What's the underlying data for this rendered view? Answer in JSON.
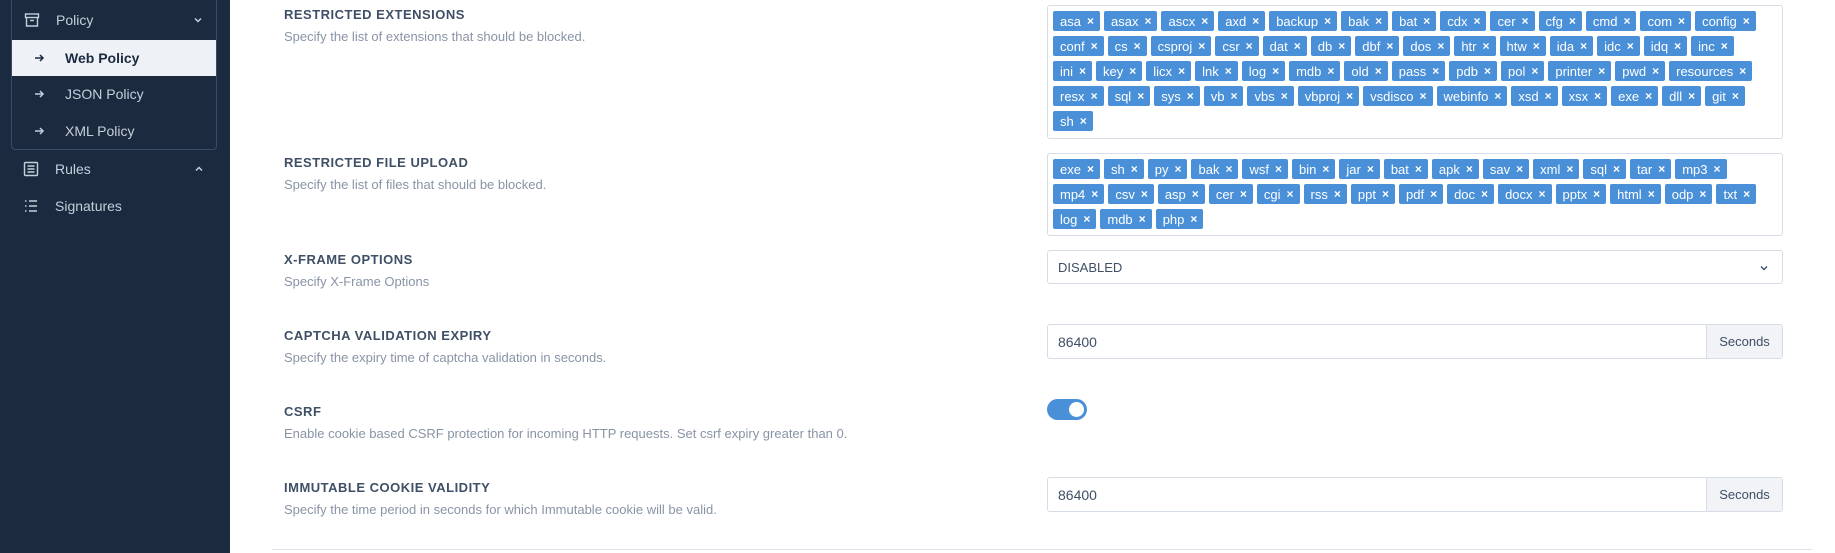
{
  "sidebar": {
    "policy_group": {
      "label": "Policy",
      "items": [
        {
          "label": "Web Policy",
          "active": true
        },
        {
          "label": "JSON Policy",
          "active": false
        },
        {
          "label": "XML Policy",
          "active": false
        }
      ]
    },
    "rules": {
      "label": "Rules"
    },
    "signatures": {
      "label": "Signatures"
    }
  },
  "settings": {
    "restricted_extensions": {
      "title": "RESTRICTED EXTENSIONS",
      "description": "Specify the list of extensions that should be blocked.",
      "tags": [
        "asa",
        "asax",
        "ascx",
        "axd",
        "backup",
        "bak",
        "bat",
        "cdx",
        "cer",
        "cfg",
        "cmd",
        "com",
        "config",
        "conf",
        "cs",
        "csproj",
        "csr",
        "dat",
        "db",
        "dbf",
        "dos",
        "htr",
        "htw",
        "ida",
        "idc",
        "idq",
        "inc",
        "ini",
        "key",
        "licx",
        "lnk",
        "log",
        "mdb",
        "old",
        "pass",
        "pdb",
        "pol",
        "printer",
        "pwd",
        "resources",
        "resx",
        "sql",
        "sys",
        "vb",
        "vbs",
        "vbproj",
        "vsdisco",
        "webinfo",
        "xsd",
        "xsx",
        "exe",
        "dll",
        "git",
        "sh"
      ]
    },
    "restricted_file_upload": {
      "title": "RESTRICTED FILE UPLOAD",
      "description": "Specify the list of files that should be blocked.",
      "tags": [
        "exe",
        "sh",
        "py",
        "bak",
        "wsf",
        "bin",
        "jar",
        "bat",
        "apk",
        "sav",
        "xml",
        "sql",
        "tar",
        "mp3",
        "mp4",
        "csv",
        "asp",
        "cer",
        "cgi",
        "rss",
        "ppt",
        "pdf",
        "doc",
        "docx",
        "pptx",
        "html",
        "odp",
        "txt",
        "log",
        "mdb",
        "php"
      ]
    },
    "x_frame_options": {
      "title": "X-FRAME OPTIONS",
      "description": "Specify X-Frame Options",
      "value": "DISABLED"
    },
    "captcha_validation_expiry": {
      "title": "CAPTCHA VALIDATION EXPIRY",
      "description": "Specify the expiry time of captcha validation in seconds.",
      "value": "86400",
      "unit": "Seconds"
    },
    "csrf": {
      "title": "CSRF",
      "description": "Enable cookie based CSRF protection for incoming HTTP requests. Set csrf expiry greater than 0.",
      "enabled": true
    },
    "immutable_cookie_validity": {
      "title": "IMMUTABLE COOKIE VALIDITY",
      "description": "Specify the time period in seconds for which Immutable cookie will be valid.",
      "value": "86400",
      "unit": "Seconds"
    }
  },
  "colors": {
    "sidebar_bg": "#1b2a3f",
    "accent": "#4a90d9",
    "title_text": "#3f4f66",
    "muted_text": "#8894a5"
  }
}
